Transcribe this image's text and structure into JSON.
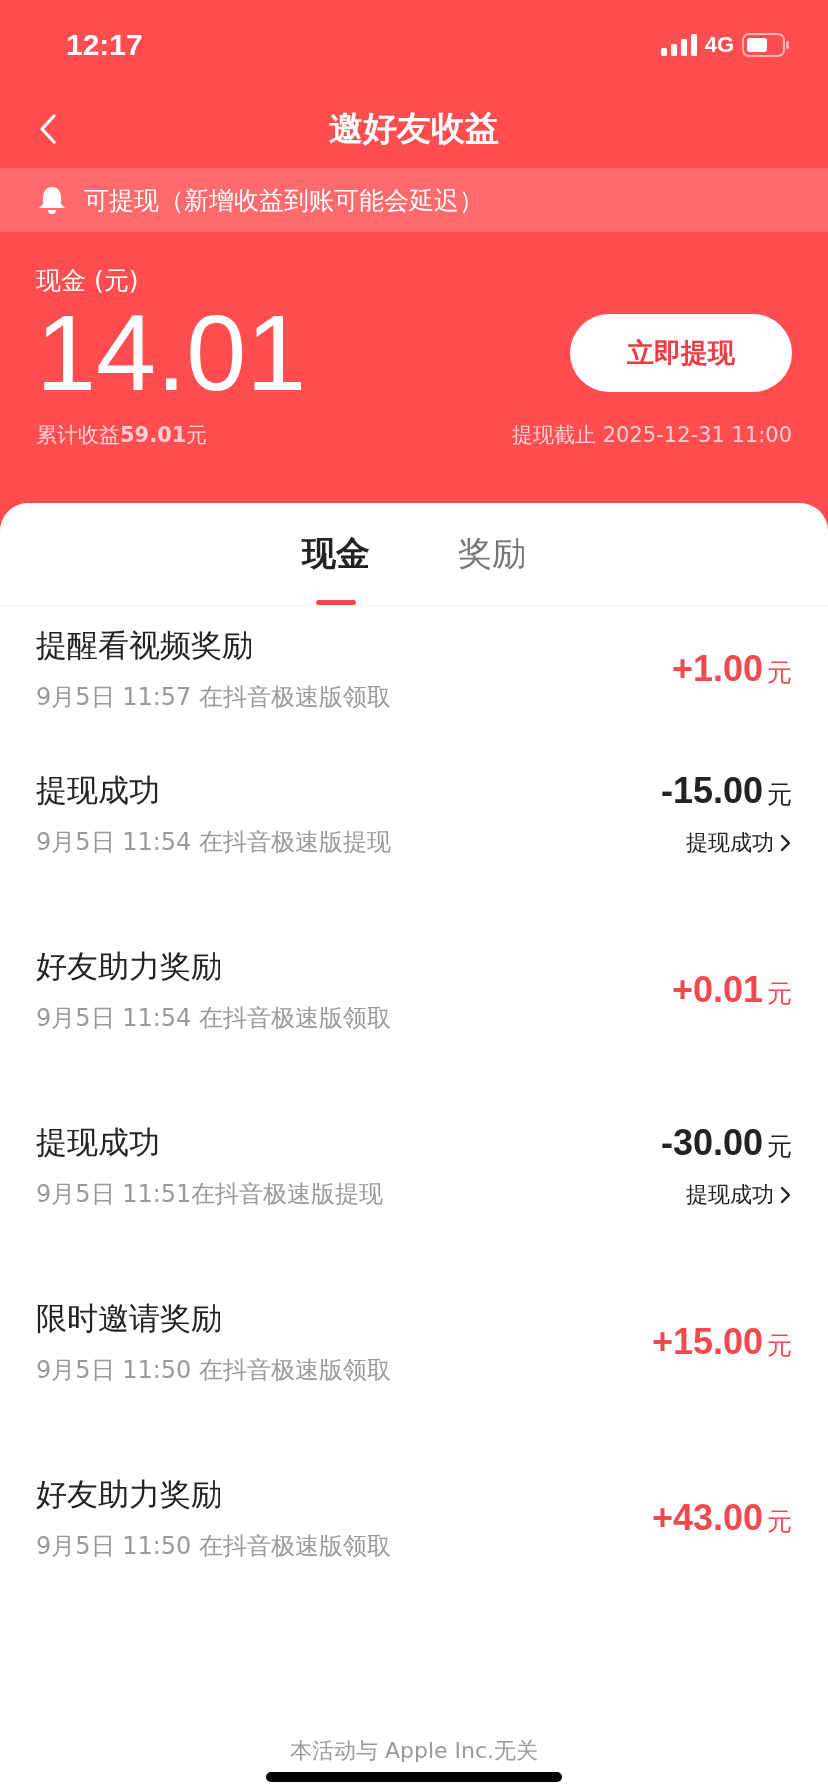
{
  "status_bar": {
    "time": "12:17",
    "network": "4G"
  },
  "nav": {
    "title": "邀好友收益"
  },
  "notice": {
    "text": "可提现（新增收益到账可能会延迟）"
  },
  "summary": {
    "label": "现金 (元)",
    "balance": "14.01",
    "button": "立即提现",
    "total": "累计收益**59.01**元",
    "deadline": "提现截止 2025-12-31 11:00"
  },
  "tabs": [
    {
      "label": "现金",
      "selected": true
    },
    {
      "label": "奖励",
      "selected": false
    }
  ],
  "records": [
    {
      "kind": "credit",
      "title": "提醒看视频奖励",
      "detail": "9月5日 11:57 在抖音极速版领取",
      "amount": "+1.00",
      "unit": "元"
    },
    {
      "kind": "debit",
      "title": "提现成功",
      "detail": "9月5日 11:54 在抖音极速版提现",
      "amount": "-15.00",
      "unit": "元",
      "status": "提现成功"
    },
    {
      "kind": "credit",
      "title": "好友助力奖励",
      "detail": "9月5日 11:54 在抖音极速版领取",
      "amount": "+0.01",
      "unit": "元"
    },
    {
      "kind": "debit",
      "title": "提现成功",
      "detail": "9月5日 11:51在抖音极速版提现",
      "amount": "-30.00",
      "unit": "元",
      "status": "提现成功"
    },
    {
      "kind": "credit",
      "title": "限时邀请奖励",
      "detail": "9月5日 11:50 在抖音极速版领取",
      "amount": "+15.00",
      "unit": "元"
    },
    {
      "kind": "credit",
      "title": "好友助力奖励",
      "detail": "9月5日 11:50 在抖音极速版领取",
      "amount": "+43.00",
      "unit": "元"
    }
  ],
  "footer": "本活动与 Apple Inc.无关"
}
